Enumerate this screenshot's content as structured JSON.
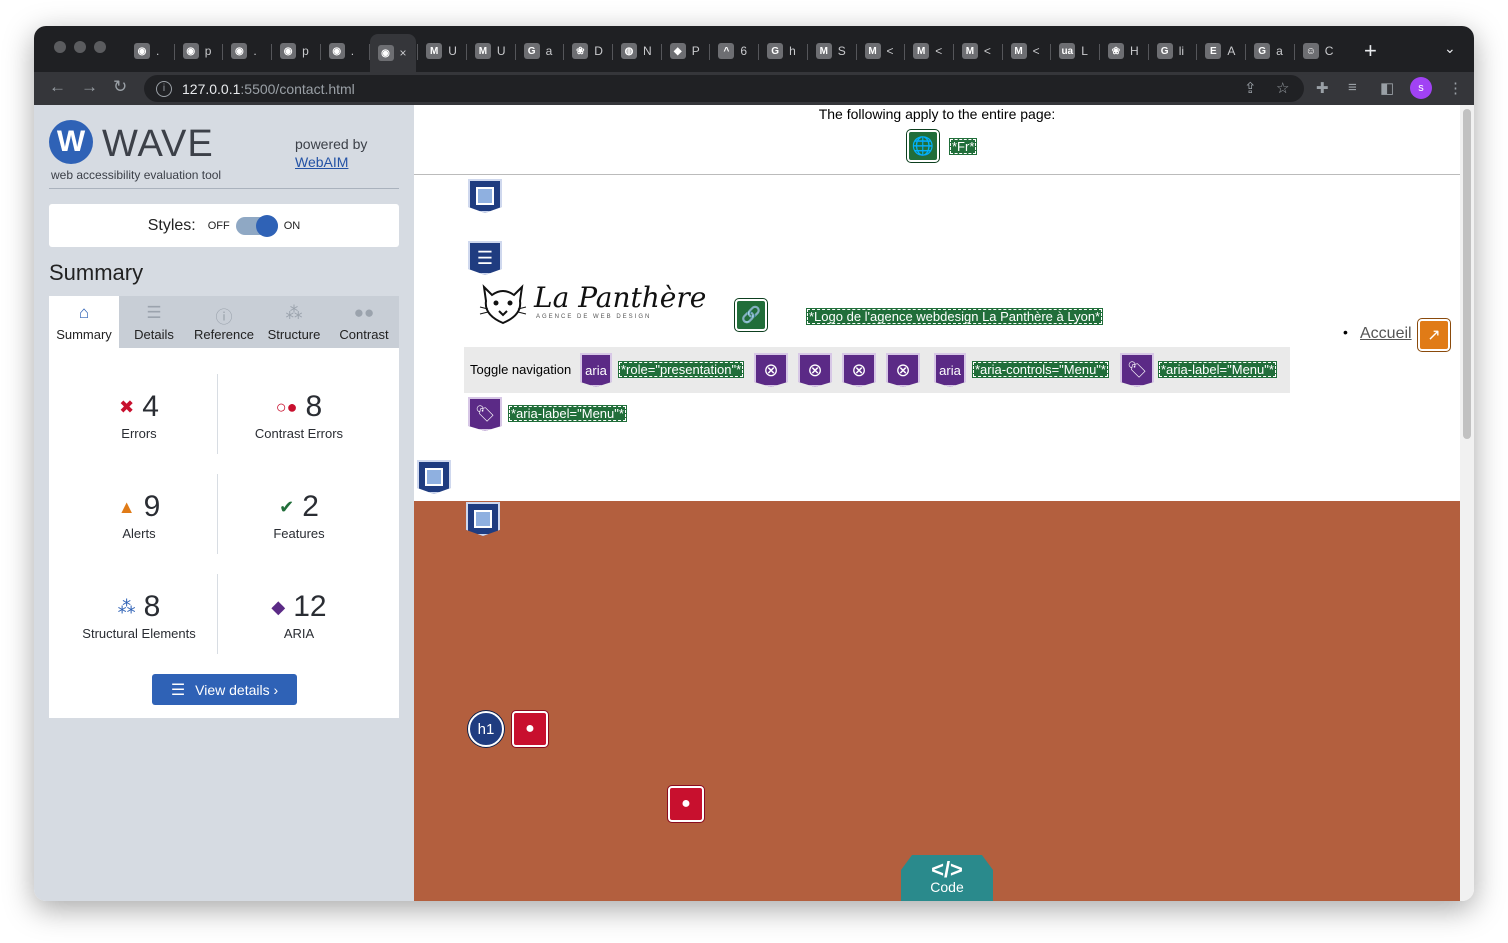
{
  "browser": {
    "tabs": [
      {
        "fav": "◉",
        "label": "."
      },
      {
        "fav": "◉",
        "label": "p"
      },
      {
        "fav": "◉",
        "label": "."
      },
      {
        "fav": "◉",
        "label": "p"
      },
      {
        "fav": "◉",
        "label": "."
      },
      {
        "fav": "◉",
        "label": "×",
        "active": true
      },
      {
        "fav": "M",
        "label": "U"
      },
      {
        "fav": "M",
        "label": "U"
      },
      {
        "fav": "G",
        "label": "a"
      },
      {
        "fav": "❀",
        "label": "D"
      },
      {
        "fav": "◍",
        "label": "N"
      },
      {
        "fav": "◆",
        "label": "P"
      },
      {
        "fav": "^",
        "label": "6"
      },
      {
        "fav": "G",
        "label": "h"
      },
      {
        "fav": "M",
        "label": "S"
      },
      {
        "fav": "M",
        "label": "<"
      },
      {
        "fav": "M",
        "label": "<"
      },
      {
        "fav": "M",
        "label": "<"
      },
      {
        "fav": "M",
        "label": "<"
      },
      {
        "fav": "ua",
        "label": "L"
      },
      {
        "fav": "❀",
        "label": "H"
      },
      {
        "fav": "G",
        "label": "li"
      },
      {
        "fav": "E",
        "label": "A"
      },
      {
        "fav": "G",
        "label": "a"
      },
      {
        "fav": "☺",
        "label": "C"
      }
    ],
    "new_tab": "+",
    "url_host": "127.0.0.1",
    "url_path": ":5500/contact.html",
    "profile_initial": "s"
  },
  "wave": {
    "logo_letter": "W",
    "logo_word": "WAVE",
    "tagline": "web accessibility evaluation tool",
    "powered_by": "powered by",
    "webaim_link": "WebAIM",
    "styles_label": "Styles:",
    "styles_off": "OFF",
    "styles_on": "ON",
    "summary_title": "Summary",
    "tabs": [
      {
        "label": "Summary",
        "icon": "home-icon"
      },
      {
        "label": "Details",
        "icon": "list-icon"
      },
      {
        "label": "Reference",
        "icon": "info-icon"
      },
      {
        "label": "Structure",
        "icon": "hierarchy-icon"
      },
      {
        "label": "Contrast",
        "icon": "contrast-icon"
      }
    ],
    "stats": {
      "errors": {
        "count": "4",
        "label": "Errors",
        "color": "#c8102e"
      },
      "contrast_errors": {
        "count": "8",
        "label": "Contrast Errors",
        "color": "#c8102e"
      },
      "alerts": {
        "count": "9",
        "label": "Alerts",
        "color": "#e07b17"
      },
      "features": {
        "count": "2",
        "label": "Features",
        "color": "#216e3a"
      },
      "structural": {
        "count": "8",
        "label": "Structural Elements",
        "color": "#2f62b6"
      },
      "aria": {
        "count": "12",
        "label": "ARIA",
        "color": "#5b2a86"
      }
    },
    "view_details": "View details ›"
  },
  "page": {
    "applies_text": "The following apply to the entire page:",
    "lang_label": "*Fr*",
    "logo_text": "La Panthère",
    "logo_subtext": "AGENCE DE WEB DESIGN",
    "logo_alt_label": "*Logo de l'agence webdesign La Panthère à Lyon*",
    "nav_link": "Accueil",
    "toggle_text": "Toggle navigation",
    "aria_badge": "aria",
    "role_label": "*role=\"presentation\"*",
    "aria_controls_label": "*aria-controls=\"Menu\"*",
    "aria_label_label": "*aria-label=\"Menu\"*",
    "aria_label_label2": "*aria-label=\"Menu\"*",
    "h1_badge": "h1",
    "code_symbol": "</>",
    "code_label": "Code",
    "accent_colors": {
      "hero": "#b35f3e",
      "code_tab": "#2a8a8c"
    }
  }
}
